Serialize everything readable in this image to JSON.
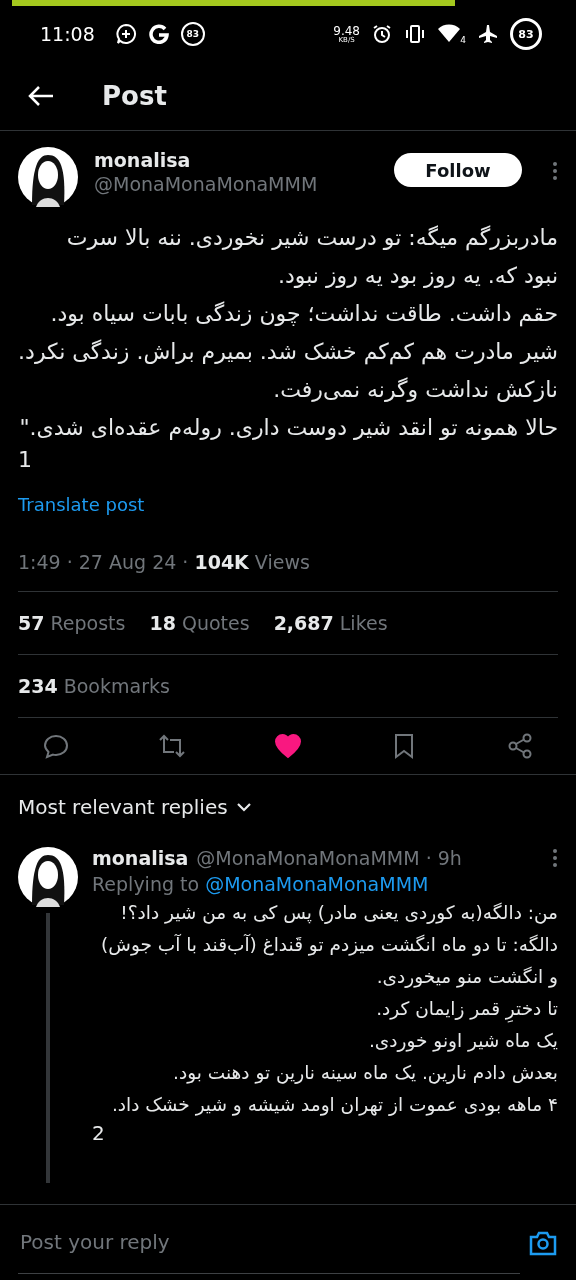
{
  "status_bar": {
    "time": "11:08",
    "left_badge": "83",
    "speed": "9.48",
    "speed_unit": "KB/S",
    "wifi_label": "4",
    "battery": "83"
  },
  "header": {
    "title": "Post"
  },
  "post": {
    "name": "monalisa",
    "handle": "@MonaMonaMonaMMM",
    "follow": "Follow",
    "text_lines": [
      "مادربزرگم میگه: تو درست شیر نخوردی. ننه بالا سرت",
      "نبود که. یه روز بود یه روز نبود.",
      "حقم داشت. طاقت نداشت؛ چون زندگی بابات سیاه بود.",
      "شیر مادرت هم کم‌کم خشک شد. بمیرم براش. زندگی نکرد.",
      "نازکش نداشت وگرنه نمی‌رفت.",
      "حالا همونه تو انقد شیر دوست داری. روله‌م عقده‌ای شدی.\""
    ],
    "number": "1",
    "translate": "Translate post",
    "time": "1:49 · 27 Aug 24 · ",
    "views": "104K",
    "views_label": " Views",
    "reposts": {
      "count": "57",
      "label": " Reposts"
    },
    "quotes": {
      "count": "18",
      "label": " Quotes"
    },
    "likes": {
      "count": "2,687",
      "label": " Likes"
    },
    "bookmarks": {
      "count": "234",
      "label": " Bookmarks"
    },
    "liked": true
  },
  "replies_header": "Most relevant replies",
  "reply": {
    "name": "monalisa",
    "handle": "@MonaMonaMonaMMM · 9h",
    "replying_to": "Replying to ",
    "replying_handle": "@MonaMonaMonaMMM",
    "text_lines": [
      "من: دالگه(به کوردی یعنی مادر) پس کی به من شیر داد؟!",
      "دالگه: تا دو ماه انگشت میزدم تو قَنداغ (آب‌قند با آب جوش)",
      "و انگشت منو میخوردی.",
      "تا دخترِ قمر زایمان کرد.",
      "یک ماه شیر اونو خوردی.",
      "بعدش دادم نارین. یک ماه سینه نارین تو دهنت بود.",
      "۴ ماهه بودی عموت از تهران اومد شیشه و شیر خشک داد."
    ],
    "number": "2"
  },
  "composer": {
    "placeholder": "Post your reply"
  }
}
